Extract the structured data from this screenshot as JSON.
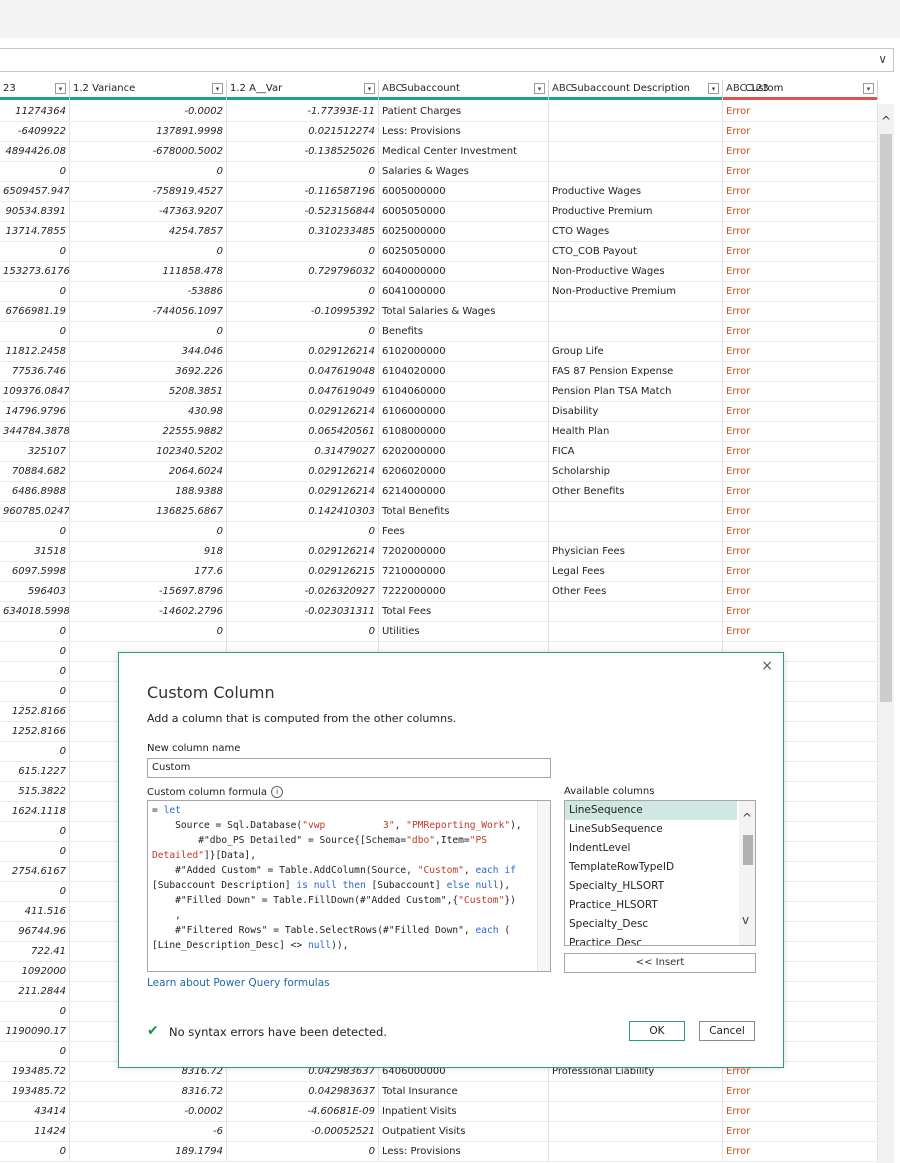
{
  "formula_bar": {
    "chevron": "∨"
  },
  "columns": [
    {
      "type": "",
      "title": "23",
      "bar": "green"
    },
    {
      "type": "",
      "title": "1.2 Variance",
      "bar": "green"
    },
    {
      "type": "",
      "title": "1.2 A__Var",
      "bar": "green"
    },
    {
      "type": "ABC",
      "title": "Subaccount",
      "bar": "green"
    },
    {
      "type": "ABC",
      "title": "Subaccount Description",
      "bar": "green-grey"
    },
    {
      "type": "ABC 123",
      "title": "Custom",
      "bar": "red"
    }
  ],
  "rows": [
    [
      "11274364",
      "-0.0002",
      "-1.77393E-11",
      "Patient Charges",
      "",
      "Error"
    ],
    [
      "-6409922",
      "137891.9998",
      "0.021512274",
      "Less: Provisions",
      "",
      "Error"
    ],
    [
      "4894426.08",
      "-678000.5002",
      "-0.138525026",
      "Medical Center Investment",
      "",
      "Error"
    ],
    [
      "0",
      "0",
      "0",
      "Salaries & Wages",
      "",
      "Error"
    ],
    [
      "6509457.947",
      "-758919.4527",
      "-0.116587196",
      "6005000000",
      "Productive Wages",
      "Error"
    ],
    [
      "90534.8391",
      "-47363.9207",
      "-0.523156844",
      "6005050000",
      "Productive Premium",
      "Error"
    ],
    [
      "13714.7855",
      "4254.7857",
      "0.310233485",
      "6025000000",
      "CTO Wages",
      "Error"
    ],
    [
      "0",
      "0",
      "0",
      "6025050000",
      "CTO_COB Payout",
      "Error"
    ],
    [
      "153273.6176",
      "111858.478",
      "0.729796032",
      "6040000000",
      "Non-Productive Wages",
      "Error"
    ],
    [
      "0",
      "-53886",
      "0",
      "6041000000",
      "Non-Productive Premium",
      "Error"
    ],
    [
      "6766981.19",
      "-744056.1097",
      "-0.10995392",
      "Total Salaries & Wages",
      "",
      "Error"
    ],
    [
      "0",
      "0",
      "0",
      "Benefits",
      "",
      "Error"
    ],
    [
      "11812.2458",
      "344.046",
      "0.029126214",
      "6102000000",
      "Group Life",
      "Error"
    ],
    [
      "77536.746",
      "3692.226",
      "0.047619048",
      "6104020000",
      "FAS 87 Pension Expense",
      "Error"
    ],
    [
      "109376.0847",
      "5208.3851",
      "0.047619049",
      "6104060000",
      "Pension Plan TSA Match",
      "Error"
    ],
    [
      "14796.9796",
      "430.98",
      "0.029126214",
      "6106000000",
      "Disability",
      "Error"
    ],
    [
      "344784.3878",
      "22555.9882",
      "0.065420561",
      "6108000000",
      "Health Plan",
      "Error"
    ],
    [
      "325107",
      "102340.5202",
      "0.31479027",
      "6202000000",
      "FICA",
      "Error"
    ],
    [
      "70884.682",
      "2064.6024",
      "0.029126214",
      "6206020000",
      "Scholarship",
      "Error"
    ],
    [
      "6486.8988",
      "188.9388",
      "0.029126214",
      "6214000000",
      "Other Benefits",
      "Error"
    ],
    [
      "960785.0247",
      "136825.6867",
      "0.142410303",
      "Total Benefits",
      "",
      "Error"
    ],
    [
      "0",
      "0",
      "0",
      "Fees",
      "",
      "Error"
    ],
    [
      "31518",
      "918",
      "0.029126214",
      "7202000000",
      "Physician Fees",
      "Error"
    ],
    [
      "6097.5998",
      "177.6",
      "0.029126215",
      "7210000000",
      "Legal Fees",
      "Error"
    ],
    [
      "596403",
      "-15697.8796",
      "-0.026320927",
      "7222000000",
      "Other Fees",
      "Error"
    ],
    [
      "634018.5998",
      "-14602.2796",
      "-0.023031311",
      "Total Fees",
      "",
      "Error"
    ],
    [
      "0",
      "0",
      "0",
      "Utilities",
      "",
      "Error"
    ],
    [
      "0",
      "",
      "",
      "",
      "",
      ""
    ],
    [
      "0",
      "",
      "",
      "",
      "",
      ""
    ],
    [
      "0",
      "",
      "",
      "",
      "",
      ""
    ],
    [
      "1252.8166",
      "",
      "",
      "",
      "",
      ""
    ],
    [
      "1252.8166",
      "",
      "",
      "",
      "",
      ""
    ],
    [
      "0",
      "",
      "",
      "",
      "",
      ""
    ],
    [
      "615.1227",
      "",
      "",
      "",
      "",
      ""
    ],
    [
      "515.3822",
      "",
      "",
      "",
      "",
      ""
    ],
    [
      "1624.1118",
      "",
      "",
      "",
      "",
      ""
    ],
    [
      "0",
      "",
      "",
      "",
      "",
      ""
    ],
    [
      "0",
      "",
      "",
      "",
      "",
      ""
    ],
    [
      "2754.6167",
      "",
      "",
      "",
      "",
      ""
    ],
    [
      "0",
      "",
      "",
      "",
      "",
      ""
    ],
    [
      "411.516",
      "",
      "",
      "",
      "",
      ""
    ],
    [
      "96744.96",
      "",
      "",
      "",
      "",
      ""
    ],
    [
      "722.41",
      "",
      "",
      "",
      "",
      ""
    ],
    [
      "1092000",
      "",
      "",
      "",
      "",
      ""
    ],
    [
      "211.2844",
      "",
      "",
      "",
      "",
      ""
    ],
    [
      "0",
      "",
      "",
      "",
      "",
      ""
    ],
    [
      "1190090.17",
      "",
      "",
      "",
      "",
      ""
    ],
    [
      "0",
      "",
      "",
      "",
      "",
      ""
    ],
    [
      "193485.72",
      "8316.72",
      "0.042983637",
      "6406000000",
      "Professional Liability",
      "Error"
    ],
    [
      "193485.72",
      "8316.72",
      "0.042983637",
      "Total Insurance",
      "",
      "Error"
    ],
    [
      "43414",
      "-0.0002",
      "-4.60681E-09",
      "Inpatient Visits",
      "",
      "Error"
    ],
    [
      "11424",
      "-6",
      "-0.00052521",
      "Outpatient Visits",
      "",
      "Error"
    ],
    [
      "0",
      "189.1794",
      "0",
      "Less: Provisions",
      "",
      "Error"
    ]
  ],
  "dialog": {
    "close": "×",
    "title": "Custom Column",
    "description": "Add a column that is computed from the other columns.",
    "new_column_label": "New column name",
    "new_column_value": "Custom",
    "formula_label": "Custom column formula",
    "formula_info": "i",
    "available_label": "Available columns",
    "available_columns": [
      "LineSequence",
      "LineSubSequence",
      "IndentLevel",
      "TemplateRowTypeID",
      "Specialty_HLSORT",
      "Practice_HLSORT",
      "Specialty_Desc",
      "Practice_Desc"
    ],
    "selected_column": "LineSequence",
    "insert_label": "<< Insert",
    "learn_link": "Learn about Power Query formulas",
    "syntax_status": "No syntax errors have been detected.",
    "ok_label": "OK",
    "cancel_label": "Cancel"
  }
}
